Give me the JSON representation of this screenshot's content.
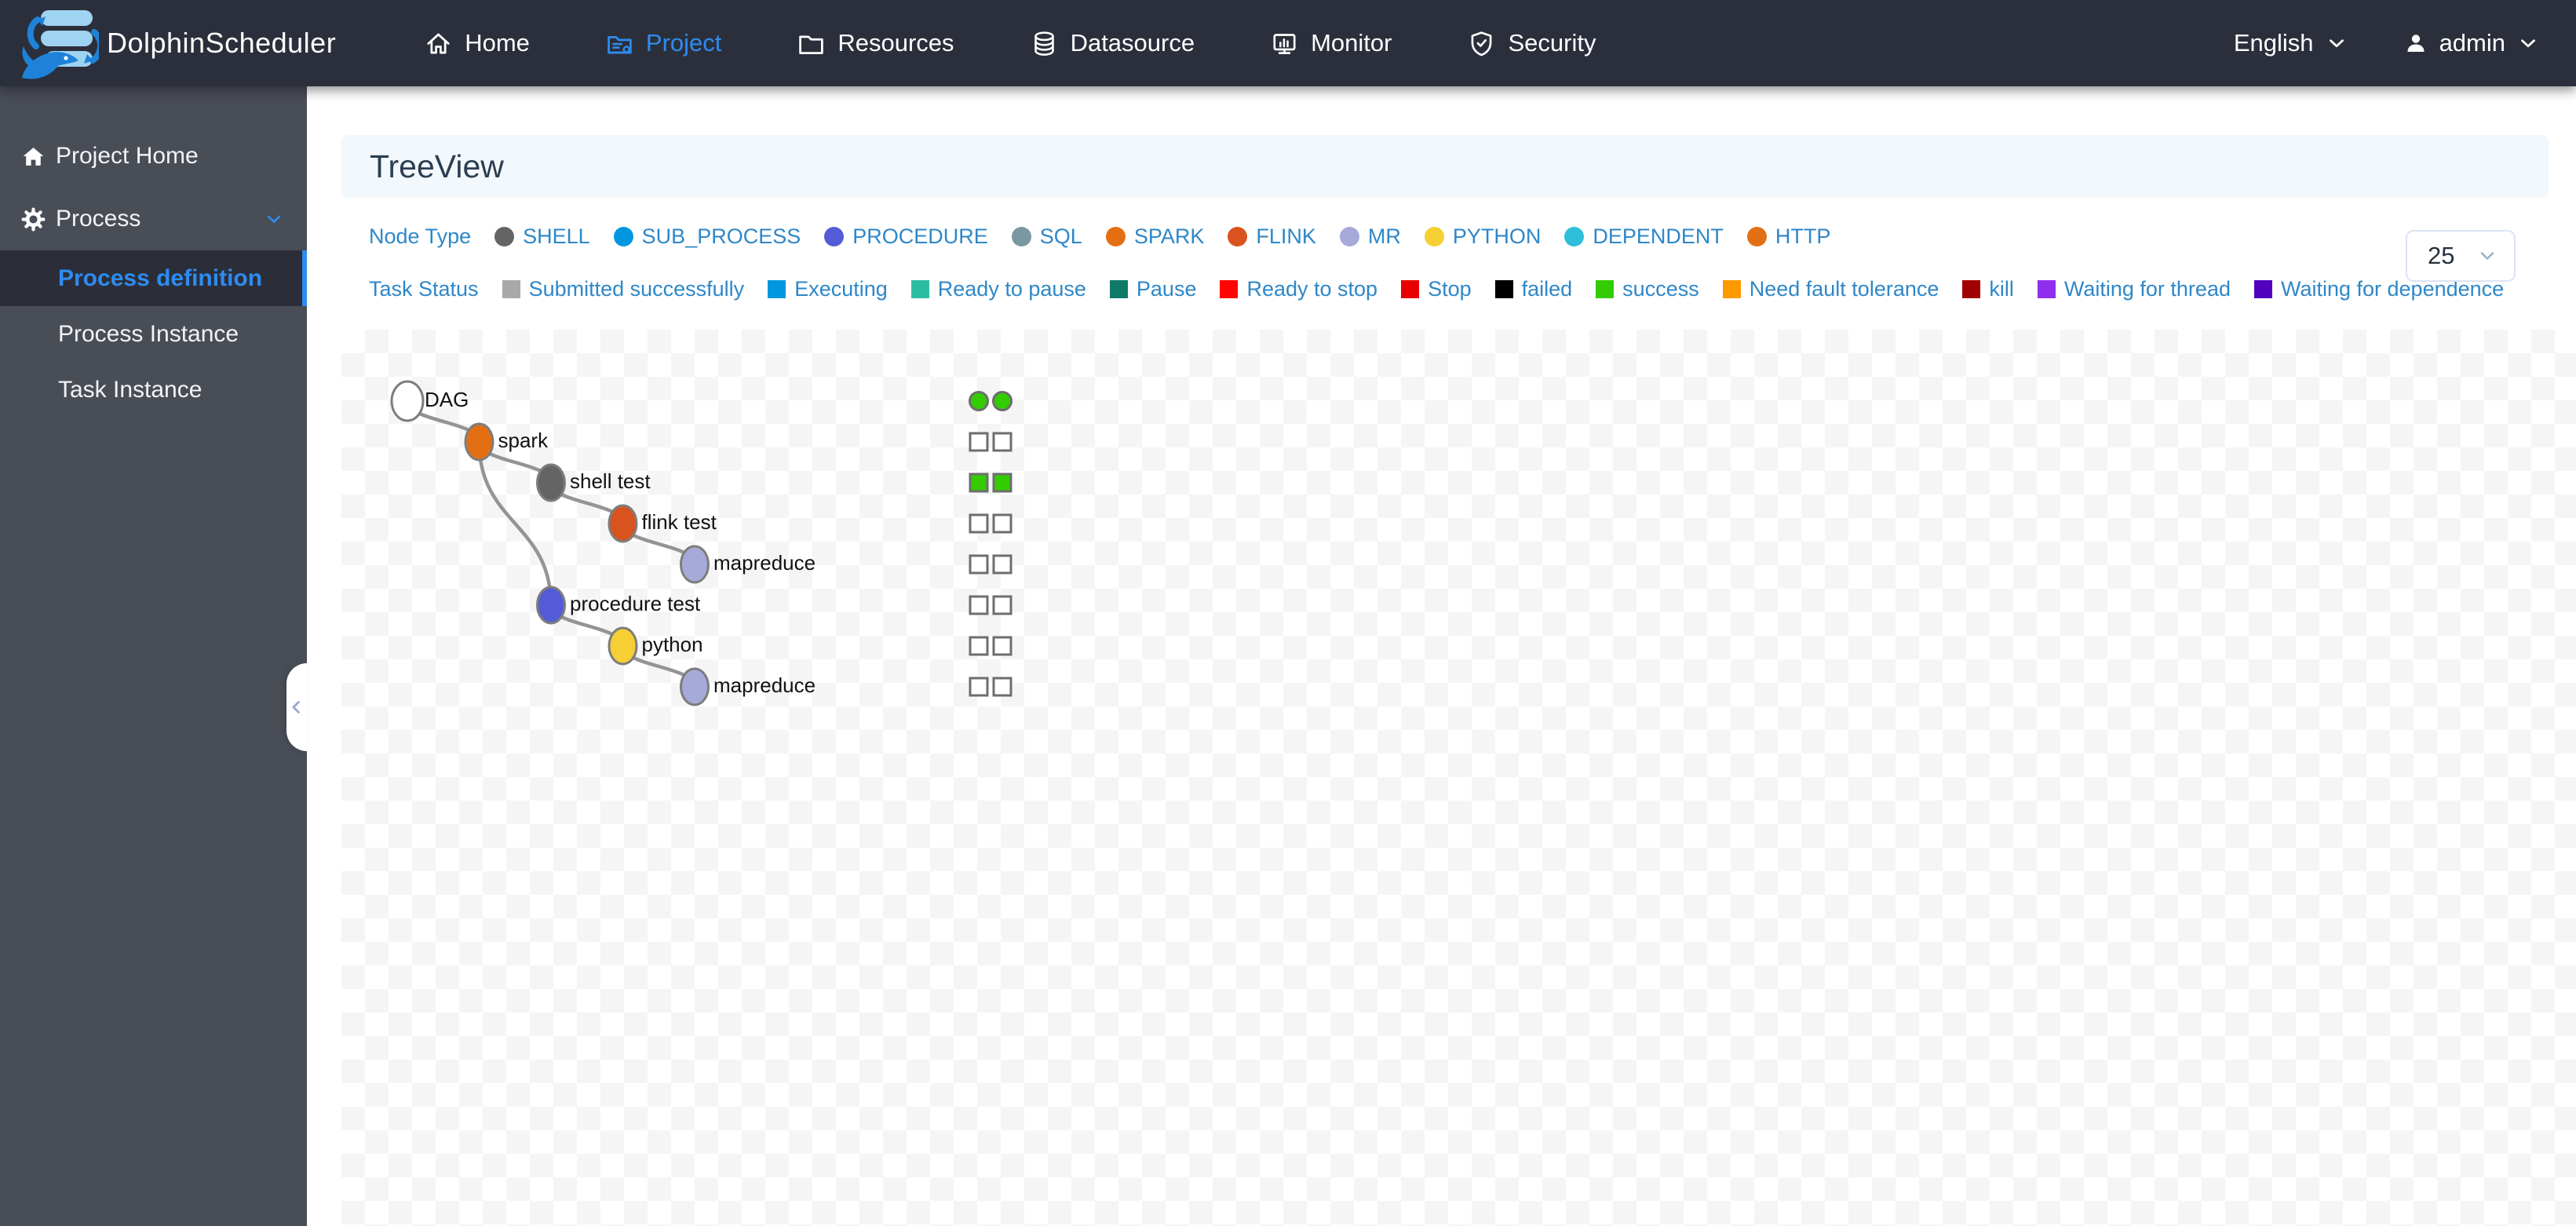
{
  "navbar": {
    "brand": "DolphinScheduler",
    "items": [
      {
        "label": "Home",
        "icon": "home",
        "active": false
      },
      {
        "label": "Project",
        "icon": "project",
        "active": true
      },
      {
        "label": "Resources",
        "icon": "folder",
        "active": false
      },
      {
        "label": "Datasource",
        "icon": "database",
        "active": false
      },
      {
        "label": "Monitor",
        "icon": "monitor",
        "active": false
      },
      {
        "label": "Security",
        "icon": "shield",
        "active": false
      }
    ],
    "language": "English",
    "user": "admin"
  },
  "sidebar": {
    "items": [
      {
        "label": "Project Home",
        "icon": "house",
        "type": "parent"
      },
      {
        "label": "Process",
        "icon": "gear",
        "type": "parent",
        "expanded": true,
        "children": [
          {
            "label": "Process definition",
            "active": true
          },
          {
            "label": "Process Instance",
            "active": false
          },
          {
            "label": "Task Instance",
            "active": false
          }
        ]
      }
    ]
  },
  "page": {
    "title": "TreeView"
  },
  "node_type_legend": {
    "label": "Node Type",
    "items": [
      {
        "name": "SHELL",
        "color": "#646464"
      },
      {
        "name": "SUB_PROCESS",
        "color": "#0097E0"
      },
      {
        "name": "PROCEDURE",
        "color": "#535CD6"
      },
      {
        "name": "SQL",
        "color": "#7A98A1"
      },
      {
        "name": "SPARK",
        "color": "#E46F13"
      },
      {
        "name": "FLINK",
        "color": "#D9531E"
      },
      {
        "name": "MR",
        "color": "#A5AAD9"
      },
      {
        "name": "PYTHON",
        "color": "#F5CF34"
      },
      {
        "name": "DEPENDENT",
        "color": "#2EBFD9"
      },
      {
        "name": "HTTP",
        "color": "#E46F13"
      }
    ]
  },
  "task_status_legend": {
    "label": "Task Status",
    "items": [
      {
        "name": "Submitted successfully",
        "color": "#A9A9A9"
      },
      {
        "name": "Executing",
        "color": "#0097E0"
      },
      {
        "name": "Ready to pause",
        "color": "#2BBDA4"
      },
      {
        "name": "Pause",
        "color": "#0F7B66"
      },
      {
        "name": "Ready to stop",
        "color": "#FE0402"
      },
      {
        "name": "Stop",
        "color": "#E90101"
      },
      {
        "name": "failed",
        "color": "#000000"
      },
      {
        "name": "success",
        "color": "#33CC00"
      },
      {
        "name": "Need fault tolerance",
        "color": "#FF9900"
      },
      {
        "name": "kill",
        "color": "#A10000"
      },
      {
        "name": "Waiting for thread",
        "color": "#912EED"
      },
      {
        "name": "Waiting for dependence",
        "color": "#5101BE"
      }
    ]
  },
  "page_size_select": {
    "value": "25"
  },
  "tree": {
    "nodes": [
      {
        "label": "DAG",
        "type": "DAG",
        "color": "#FFFFFF",
        "level": 0,
        "row": 0
      },
      {
        "label": "spark",
        "type": "SPARK",
        "color": "#E46F13",
        "level": 1,
        "row": 1
      },
      {
        "label": "shell test",
        "type": "SHELL",
        "color": "#646464",
        "level": 2,
        "row": 2
      },
      {
        "label": "flink test",
        "type": "FLINK",
        "color": "#D9531E",
        "level": 3,
        "row": 3
      },
      {
        "label": "mapreduce",
        "type": "MR",
        "color": "#A5AAD9",
        "level": 4,
        "row": 4
      },
      {
        "label": "procedure test",
        "type": "PROCEDURE",
        "color": "#535CD6",
        "level": 2,
        "row": 5
      },
      {
        "label": "python",
        "type": "PYTHON",
        "color": "#F5CF34",
        "level": 3,
        "row": 6
      },
      {
        "label": "mapreduce",
        "type": "MR",
        "color": "#A5AAD9",
        "level": 4,
        "row": 7
      }
    ],
    "links": [
      [
        0,
        1
      ],
      [
        1,
        2
      ],
      [
        2,
        3
      ],
      [
        3,
        4
      ],
      [
        1,
        5
      ],
      [
        5,
        6
      ],
      [
        6,
        7
      ]
    ],
    "indicators": [
      {
        "shape": "circle",
        "cells": [
          "success",
          "success"
        ]
      },
      {
        "shape": "square",
        "cells": [
          "empty",
          "empty"
        ]
      },
      {
        "shape": "square",
        "cells": [
          "success",
          "success"
        ]
      },
      {
        "shape": "square",
        "cells": [
          "empty",
          "empty"
        ]
      },
      {
        "shape": "square",
        "cells": [
          "empty",
          "empty"
        ]
      },
      {
        "shape": "square",
        "cells": [
          "empty",
          "empty"
        ]
      },
      {
        "shape": "square",
        "cells": [
          "empty",
          "empty"
        ]
      },
      {
        "shape": "square",
        "cells": [
          "empty",
          "empty"
        ]
      }
    ],
    "state_colors": {
      "success": "#33CC00",
      "empty": "#FFFFFF"
    }
  }
}
